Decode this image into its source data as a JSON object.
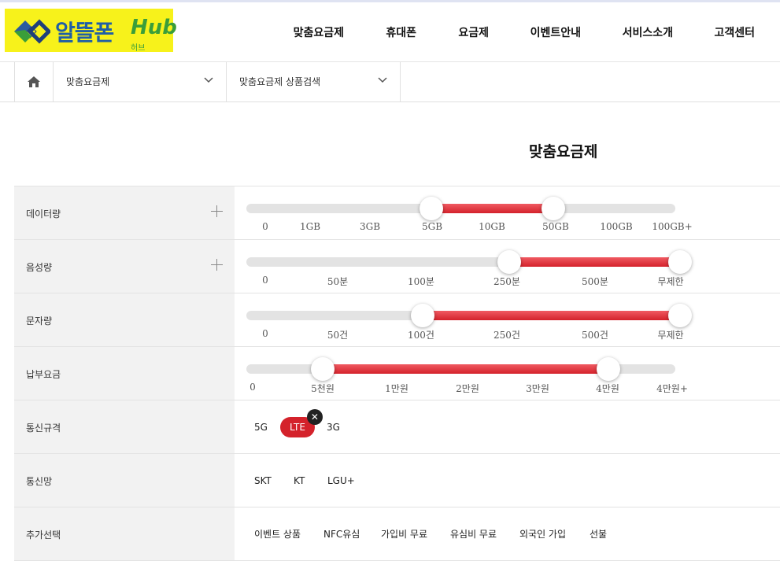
{
  "logo": {
    "name": "알뜰폰",
    "brand": "Hub",
    "sub": "허브"
  },
  "nav": [
    "맞춤요금제",
    "휴대폰",
    "요금제",
    "이벤트안내",
    "서비스소개",
    "고객센터"
  ],
  "breadcrumb": {
    "level1": "맞춤요금제",
    "level2": "맞춤요금제 상품검색"
  },
  "page_title": "맞춤요금제",
  "colors": {
    "accent": "#d4222b",
    "logo_bg": "#f7f21b",
    "logo_text": "#1f5fa6"
  },
  "filters": {
    "data": {
      "label": "데이터량",
      "ticks": [
        "0",
        "1GB",
        "3GB",
        "5GB",
        "10GB",
        "50GB",
        "100GB",
        "100GB+"
      ],
      "range": [
        "5GB",
        "50GB"
      ]
    },
    "voice": {
      "label": "음성량",
      "ticks": [
        "0",
        "50분",
        "100분",
        "250분",
        "500분",
        "무제한"
      ],
      "range": [
        "250분",
        "무제한"
      ]
    },
    "sms": {
      "label": "문자량",
      "ticks": [
        "0",
        "50건",
        "100건",
        "250건",
        "500건",
        "무제한"
      ],
      "range": [
        "100건",
        "무제한"
      ]
    },
    "fee": {
      "label": "납부요금",
      "ticks": [
        "0",
        "5천원",
        "1만원",
        "2만원",
        "3만원",
        "4만원",
        "4만원+"
      ],
      "range": [
        "5천원",
        "4만원"
      ]
    },
    "network_type": {
      "label": "통신규격",
      "options": [
        "5G",
        "LTE",
        "3G"
      ],
      "selected": "LTE",
      "remove": "✕"
    },
    "carrier": {
      "label": "통신망",
      "options": [
        "SKT",
        "KT",
        "LGU+"
      ]
    },
    "extras": {
      "label": "추가선택",
      "options": [
        "이벤트 상품",
        "NFC유심",
        "가입비 무료",
        "유심비 무료",
        "외국인 가입",
        "선불"
      ]
    }
  }
}
